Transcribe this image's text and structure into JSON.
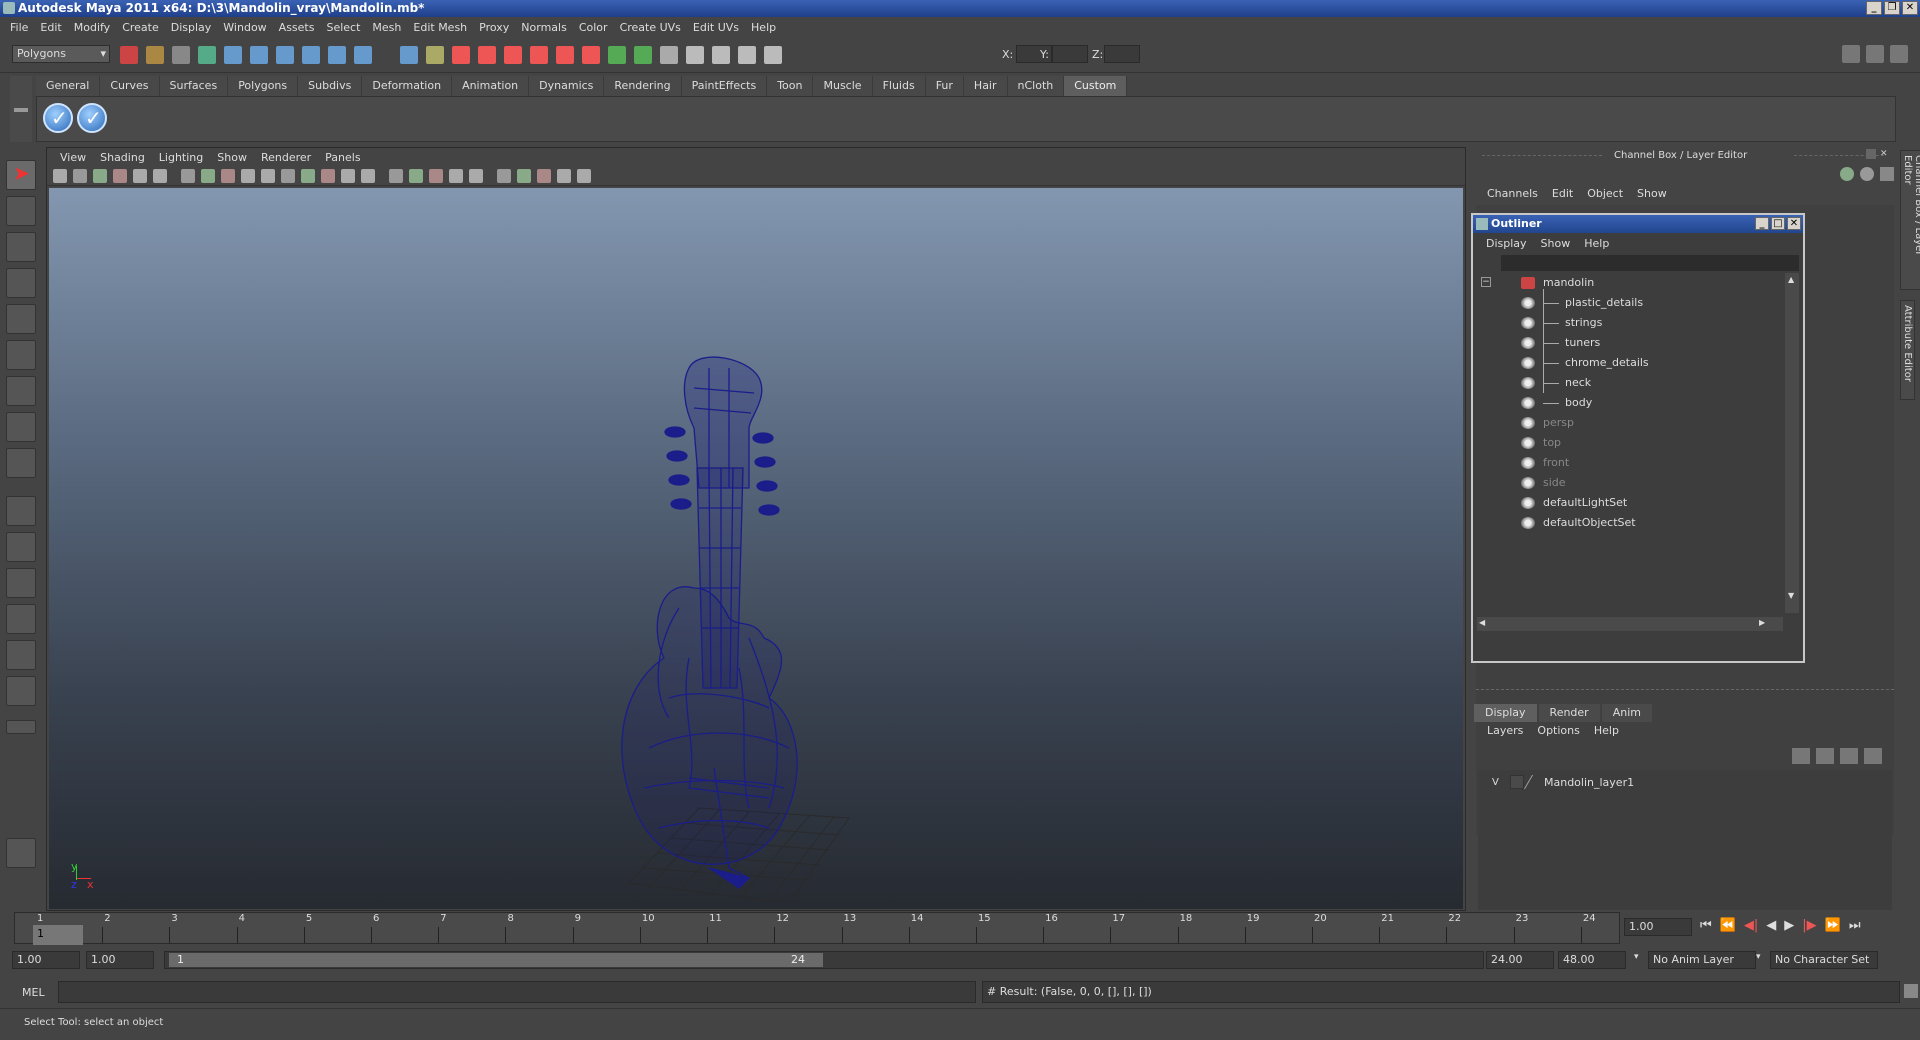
{
  "window": {
    "title": "Autodesk Maya 2011 x64: D:\\3\\Mandolin_vray\\Mandolin.mb*"
  },
  "menubar": [
    "File",
    "Edit",
    "Modify",
    "Create",
    "Display",
    "Window",
    "Assets",
    "Select",
    "Mesh",
    "Edit Mesh",
    "Proxy",
    "Normals",
    "Color",
    "Create UVs",
    "Edit UVs",
    "Help"
  ],
  "statusline": {
    "mode": "Polygons",
    "x_label": "X:",
    "y_label": "Y:",
    "z_label": "Z:"
  },
  "shelf": {
    "tabs": [
      "General",
      "Curves",
      "Surfaces",
      "Polygons",
      "Subdivs",
      "Deformation",
      "Animation",
      "Dynamics",
      "Rendering",
      "PaintEffects",
      "Toon",
      "Muscle",
      "Fluids",
      "Fur",
      "Hair",
      "nCloth",
      "Custom"
    ],
    "active_tab": "Custom"
  },
  "viewport": {
    "menu": [
      "View",
      "Shading",
      "Lighting",
      "Show",
      "Renderer",
      "Panels"
    ],
    "axis_y": "y",
    "axis_x": "x",
    "axis_z": "z"
  },
  "channelbox": {
    "title": "Channel Box / Layer Editor",
    "menu": [
      "Channels",
      "Edit",
      "Object",
      "Show"
    ]
  },
  "outliner": {
    "title": "Outliner",
    "menu": [
      "Display",
      "Show",
      "Help"
    ],
    "items": [
      {
        "label": "mandolin",
        "dim": false
      },
      {
        "label": "plastic_details",
        "dim": false
      },
      {
        "label": "strings",
        "dim": false
      },
      {
        "label": "tuners",
        "dim": false
      },
      {
        "label": "chrome_details",
        "dim": false
      },
      {
        "label": "neck",
        "dim": false
      },
      {
        "label": "body",
        "dim": false
      },
      {
        "label": "persp",
        "dim": true
      },
      {
        "label": "top",
        "dim": true
      },
      {
        "label": "front",
        "dim": true
      },
      {
        "label": "side",
        "dim": true
      },
      {
        "label": "defaultLightSet",
        "dim": false
      },
      {
        "label": "defaultObjectSet",
        "dim": false
      }
    ]
  },
  "layers": {
    "tabs": [
      "Display",
      "Render",
      "Anim"
    ],
    "active_tab": "Display",
    "menu": [
      "Layers",
      "Options",
      "Help"
    ],
    "visible_flag": "V",
    "layer_name": "Mandolin_layer1"
  },
  "side_tabs": [
    "Channel Box / Layer Editor",
    "Attribute Editor"
  ],
  "timeline": {
    "ticks": [
      "1",
      "2",
      "3",
      "4",
      "5",
      "6",
      "7",
      "8",
      "9",
      "10",
      "11",
      "12",
      "13",
      "14",
      "15",
      "16",
      "17",
      "18",
      "19",
      "20",
      "21",
      "22",
      "23",
      "24"
    ],
    "current_frame": "1",
    "current_time": "1.00"
  },
  "range": {
    "start": "1.00",
    "start2": "1.00",
    "slider_start": "1",
    "slider_end": "24",
    "end": "24.00",
    "end2": "48.00",
    "anim_layer": "No Anim Layer",
    "char_set": "No Character Set"
  },
  "mel": {
    "label": "MEL",
    "result": "# Result: (False, 0, 0, [], [], [])"
  },
  "help": {
    "text": "Select Tool: select an object"
  }
}
